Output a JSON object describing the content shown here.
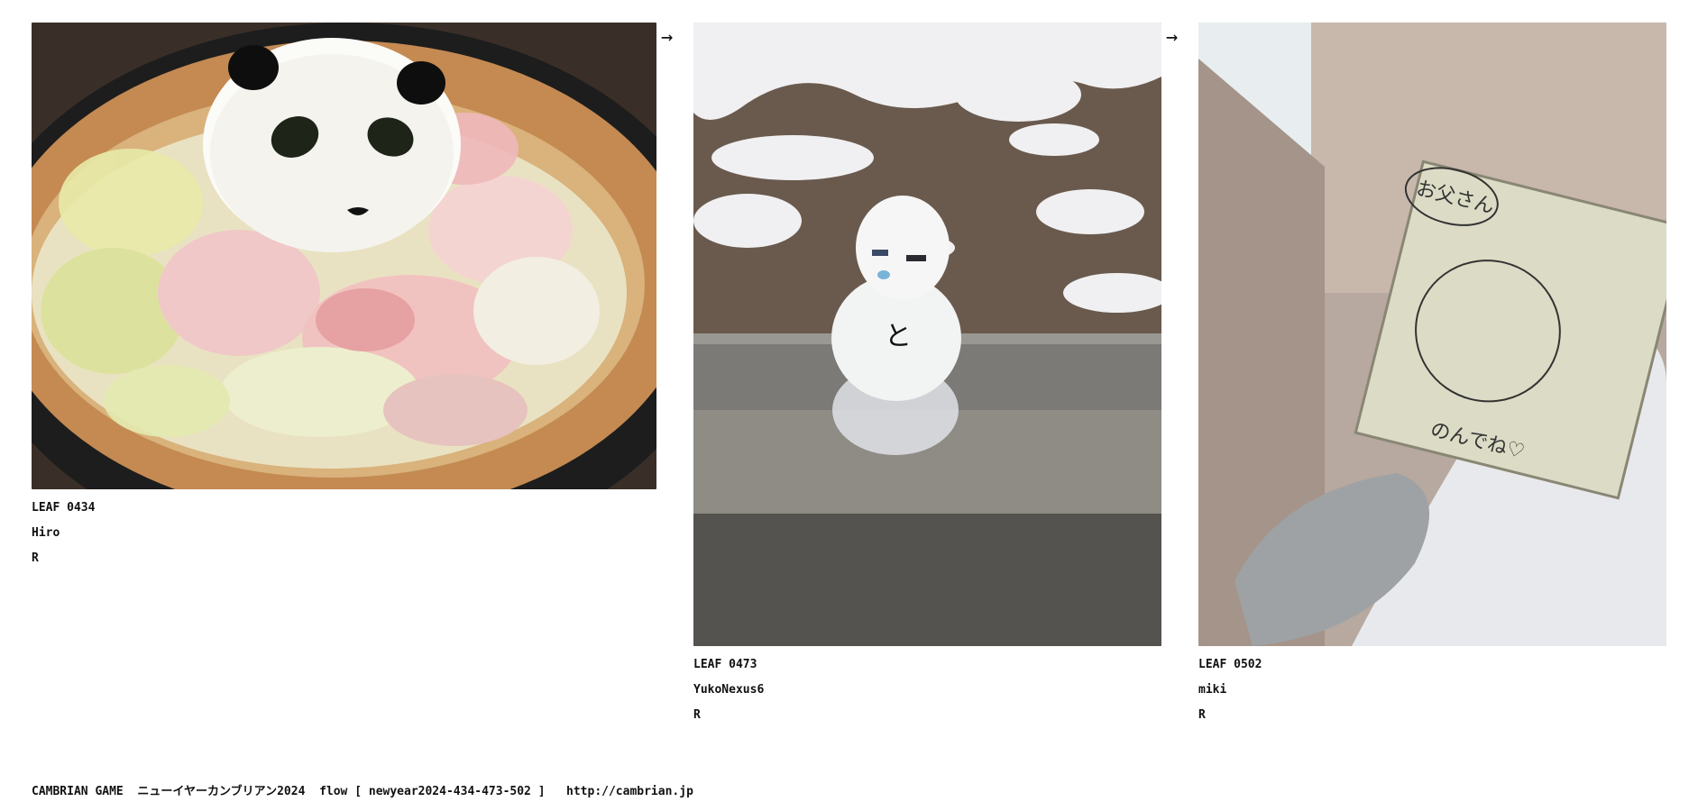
{
  "leaves": [
    {
      "id": "LEAF 0434",
      "author": "Hiro",
      "mark": "R"
    },
    {
      "id": "LEAF 0473",
      "author": "YukoNexus6",
      "mark": "R"
    },
    {
      "id": "LEAF 0502",
      "author": "miki",
      "mark": "R"
    }
  ],
  "arrows": {
    "arrow_1": "→",
    "arrow_2": "→"
  },
  "drawings": {
    "snowman_mark": "と",
    "card_bubble": "お父さん",
    "card_signature": "のんでね♡"
  },
  "footer": {
    "game": "CAMBRIAN GAME",
    "title": "ニューイヤーカンブリアン2024",
    "flow": "flow [ newyear2024-434-473-502 ]",
    "url": "http://cambrian.jp"
  },
  "colors": {
    "text": "#111111",
    "background": "#ffffff"
  }
}
